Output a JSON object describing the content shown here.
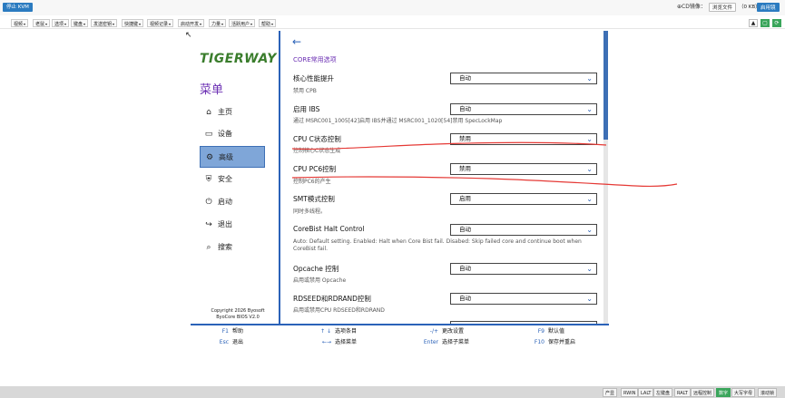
{
  "kvm": {
    "stop_label": "停止 KVM",
    "cd_label": "⊕CD镜像：",
    "browse_label": "浏览文件",
    "size_label": "（0 KB）",
    "start_label": "启用镜"
  },
  "menu": {
    "items": [
      "视频",
      "老鼠",
      "选项",
      "键盘",
      "发送密钥",
      "快捷键",
      "视频记录",
      "启动开发",
      "力量",
      "活跃用户",
      "帮助"
    ]
  },
  "bios": {
    "logo": "TIGERWAY",
    "menu_title": "菜单",
    "nav": [
      {
        "icon": "⌂",
        "label": "主页"
      },
      {
        "icon": "▭",
        "label": "设备"
      },
      {
        "icon": "⚙",
        "label": "高级"
      },
      {
        "icon": "⛨",
        "label": "安全"
      },
      {
        "icon": "⏻",
        "label": "启动"
      },
      {
        "icon": "↪",
        "label": "退出"
      },
      {
        "icon": "⌕",
        "label": "搜索"
      }
    ],
    "copyright_line1": "Copyright 2026 Byosoft",
    "copyright_line2": "ByoCore BIOS V2.0",
    "back": "←",
    "section_title": "CORE常用选项",
    "options": [
      {
        "label": "核心性能提升",
        "desc": "禁用 CPB",
        "value": "自动"
      },
      {
        "label": "启用 IBS",
        "desc": "通过 MSRC001_1005[42]启用 IBS并通过 MSRC001_1020[54]禁用 SpecLockMap",
        "value": "自动"
      },
      {
        "label": "CPU C状态控制",
        "desc": "控制核心C状态生成",
        "value": "禁用"
      },
      {
        "label": "CPU PC6控制",
        "desc": "控制PC6的产生",
        "value": "禁用"
      },
      {
        "label": "SMT模式控制",
        "desc": "同时多线程。",
        "value": "启用"
      },
      {
        "label": "CoreBist Halt Control",
        "desc": "Auto: Default setting. Enabled: Halt when Core Bist fail. Disabed: Skip failed core and continue boot when CoreBist fail.",
        "value": "自动"
      },
      {
        "label": "Opcache 控制",
        "desc": "启用或禁用 Opcache",
        "value": "自动"
      },
      {
        "label": "RDSEED和RDRAND控制",
        "desc": "启用或禁用CPU RDSEED和RDRAND",
        "value": "自动"
      }
    ]
  },
  "help": {
    "f1_key": "F1",
    "f1_label": "帮助",
    "esc_key": "Esc",
    "esc_label": "退出",
    "ud_key": "↑ ↓",
    "ud_label": "选项条目",
    "lr_key": "←→",
    "lr_label": "选择菜单",
    "pm_key": "-/+",
    "pm_label": "更改设置",
    "enter_key": "Enter",
    "enter_label": "选择子菜单",
    "f9_key": "F9",
    "f9_label": "默认值",
    "f10_key": "F10",
    "f10_label": "保存并重启"
  },
  "status": {
    "items": [
      "产显",
      "RWIN",
      "LALT",
      "左键盘",
      "RALT",
      "远程控制",
      "数字",
      "大写字母",
      "滚动锁"
    ]
  },
  "colors": {
    "accent_blue": "#2b62b8",
    "purple": "#6b2fb3",
    "active_nav": "#7fa6d8",
    "annotation_red": "#e53935",
    "logo_green": "#3a7d2c"
  }
}
